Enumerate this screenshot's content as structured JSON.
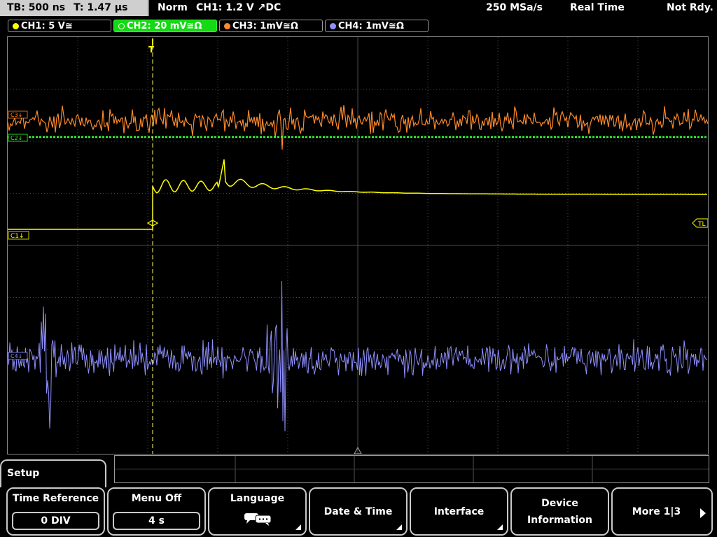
{
  "header": {
    "timebase": "TB: 500 ns",
    "trigger_time": "T: 1.47 µs",
    "mode": "Norm",
    "trigger": "CH1: 1.2 V ↗DC",
    "sample_rate": "250 MSa/s",
    "acq_mode": "Real Time",
    "status": "Not Rdy."
  },
  "channels": [
    {
      "label": "CH1: 5 V≅",
      "color": "#ffff00",
      "active": false
    },
    {
      "label": "CH2: 20 mV≅Ω",
      "color": "#33ff33",
      "active": true
    },
    {
      "label": "CH3: 1mV≅Ω",
      "color": "#ff8a2b",
      "active": false
    },
    {
      "label": "CH4: 1mV≅Ω",
      "color": "#8f8fff",
      "active": false
    }
  ],
  "markers": {
    "c1": "C1↓",
    "c2": "C2↓",
    "c3": "C3↓",
    "c4": "C4↓",
    "trigger_level": "TL",
    "trigger_pos": "T"
  },
  "menu": {
    "title": "Setup",
    "softkeys": [
      {
        "label": "Time Reference",
        "value": "0 DIV"
      },
      {
        "label": "Menu Off",
        "value": "4 s"
      },
      {
        "label": "Language",
        "icon": "speech-bubbles-icon"
      },
      {
        "label": "Date & Time"
      },
      {
        "label": "Interface"
      },
      {
        "label_line1": "Device",
        "label_line2": "Information"
      },
      {
        "label": "More 1|3"
      }
    ]
  },
  "colors": {
    "ch1": "#ffff00",
    "ch2": "#33ff33",
    "ch3": "#ff8a2b",
    "ch4": "#8f8fff",
    "grid": "#555555",
    "trigger": "#ffff55"
  }
}
